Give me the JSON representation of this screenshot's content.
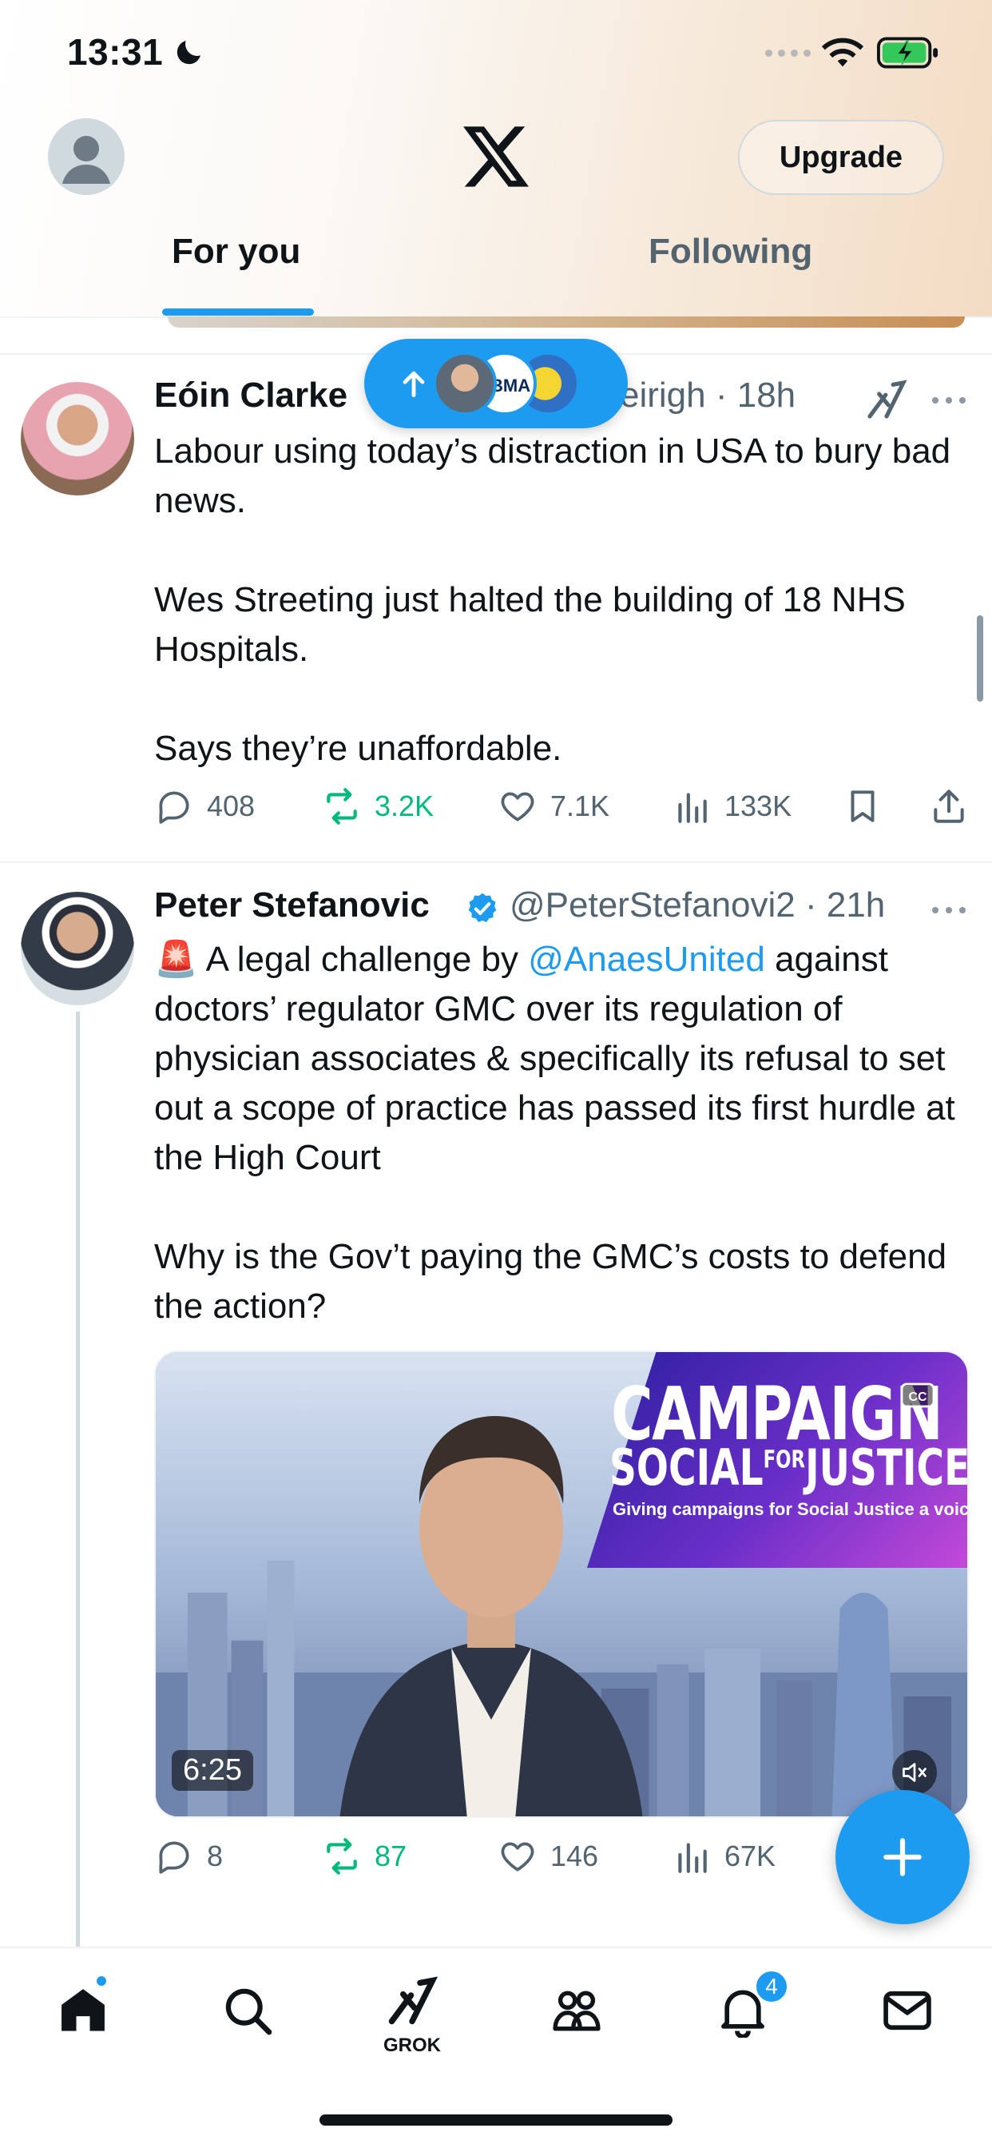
{
  "status_bar": {
    "time": "13:31",
    "icons": [
      "moon-icon",
      "signal-icon",
      "wifi-icon",
      "battery-charging-icon"
    ]
  },
  "header": {
    "logo": "x-logo",
    "upgrade_label": "Upgrade",
    "tabs": [
      {
        "label": "For you",
        "active": true
      },
      {
        "label": "Following",
        "active": false
      }
    ]
  },
  "new_posts_pill": {
    "icon": "arrow-up-icon",
    "avatar_text": "BMA"
  },
  "posts": [
    {
      "name": "Eóin Clarke",
      "meta": "eirigh · 18h",
      "text": [
        "Labour using today’s distraction in USA to bury bad news.",
        "",
        "Wes Streeting just halted the building of 18 NHS Hospitals.",
        "",
        "Says they’re unaffordable."
      ],
      "actions": {
        "replies": "408",
        "reposts": "3.2K",
        "likes": "7.1K",
        "views": "133K"
      }
    },
    {
      "name": "Peter Stefanovic",
      "verified": true,
      "meta": "@PeterStefanovi2 · 21h",
      "emoji": "🚨",
      "text_part1": " A legal challenge by ",
      "mention": "@AnaesUnited",
      "text_part2": " against doctors’ regulator GMC over its regulation of physician associates & specifically its refusal to set out a scope of practice has passed its first hurdle at the High Court",
      "text_part3": "Why is the Gov’t paying the GMC’s costs to defend the action?",
      "video": {
        "duration": "6:25",
        "banner_line1": "CAMPAIGN",
        "banner_line2_a": "SOCIAL",
        "banner_line2_b": "FOR",
        "banner_line2_c": "JUSTICE",
        "banner_tagline": "Giving campaigns for Social Justice a voice"
      },
      "actions": {
        "replies": "8",
        "reposts": "87",
        "likes": "146",
        "views": "67K"
      }
    }
  ],
  "bottom_nav": {
    "items": [
      "home-icon",
      "search-icon",
      "grok-icon",
      "communities-icon",
      "notifications-icon",
      "messages-icon"
    ],
    "grok_label": "GROK",
    "notification_count": "4"
  },
  "colors": {
    "accent": "#1d9bf0",
    "repost_green": "#00ba7c",
    "secondary_text": "#536471"
  }
}
